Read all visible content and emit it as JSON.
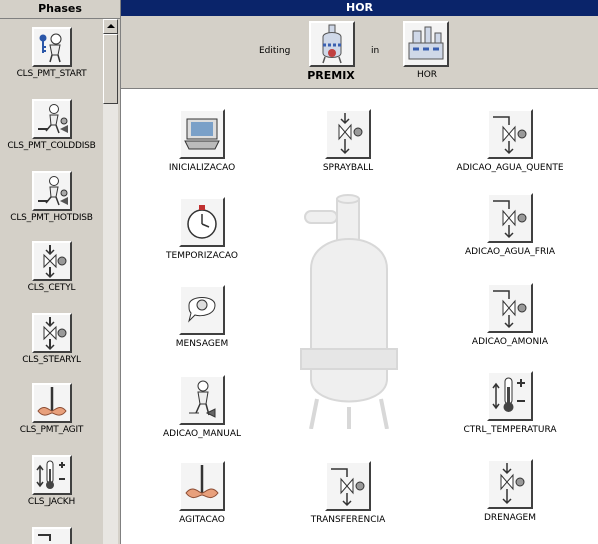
{
  "left_panel": {
    "title": "Phases",
    "items": [
      {
        "label": "CLS_PMT_START",
        "icon": "person-with-key-icon"
      },
      {
        "label": "CLS_PMT_COLDDISB",
        "icon": "person-with-valve-icon"
      },
      {
        "label": "CLS_PMT_HOTDISB",
        "icon": "person-with-valve-icon"
      },
      {
        "label": "CLS_CETYL",
        "icon": "valve-icon"
      },
      {
        "label": "CLS_STEARYL",
        "icon": "valve-icon"
      },
      {
        "label": "CLS_PMT_AGIT",
        "icon": "agitator-icon"
      },
      {
        "label": "CLS_JACKH",
        "icon": "thermometer-icon"
      }
    ]
  },
  "right_panel": {
    "title": "HOR",
    "editing_label": "Editing",
    "unit_name": "PREMIX",
    "in_label": "in",
    "area_name": "HOR"
  },
  "steps": [
    {
      "label": "INICIALIZACAO",
      "icon": "computer-icon"
    },
    {
      "label": "SPRAYBALL",
      "icon": "valve-icon"
    },
    {
      "label": "ADICAO_AGUA_QUENTE",
      "icon": "pipe-valve-icon"
    },
    {
      "label": "TEMPORIZACAO",
      "icon": "stopwatch-icon"
    },
    {
      "label": "ADICAO_AGUA_FRIA",
      "icon": "pipe-valve-icon"
    },
    {
      "label": "MENSAGEM",
      "icon": "message-person-icon"
    },
    {
      "label": "ADICAO_AMONIA",
      "icon": "pipe-valve-icon"
    },
    {
      "label": "ADICAO_MANUAL",
      "icon": "person-with-valve-icon"
    },
    {
      "label": "CTRL_TEMPERATURA",
      "icon": "thermometer-icon"
    },
    {
      "label": "AGITACAO",
      "icon": "agitator-icon"
    },
    {
      "label": "TRANSFERENCIA",
      "icon": "pipe-valve-icon"
    },
    {
      "label": "DRENAGEM",
      "icon": "valve-icon"
    }
  ]
}
